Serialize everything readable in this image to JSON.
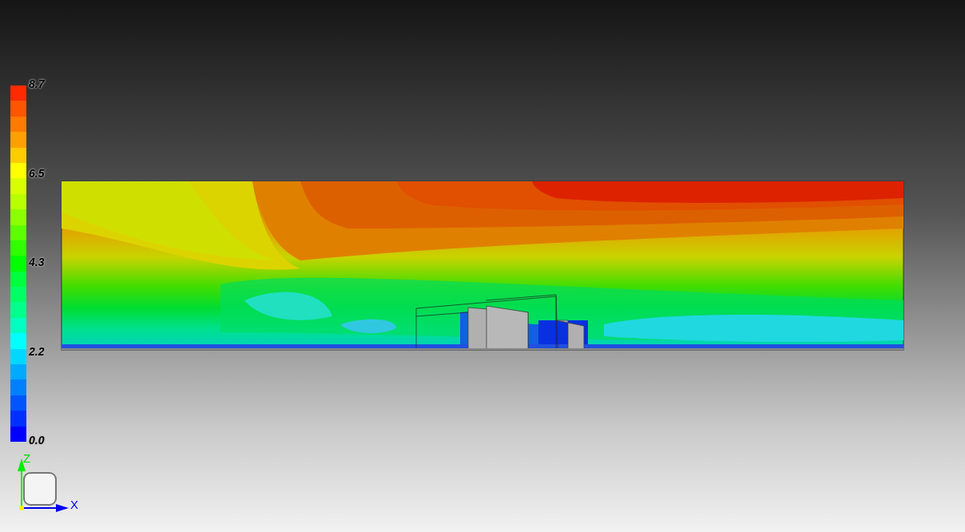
{
  "legend": {
    "labels": [
      "8.7",
      "6.5",
      "4.3",
      "2.2",
      "0.0"
    ]
  },
  "axes": {
    "vertical": "Z",
    "horizontal": "X"
  }
}
